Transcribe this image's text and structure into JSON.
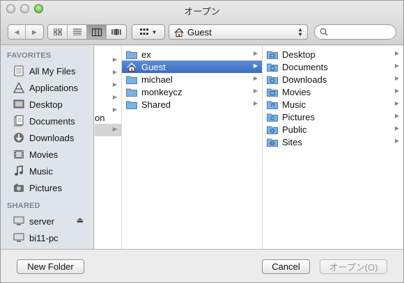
{
  "window": {
    "title": "オープン"
  },
  "toolbar": {
    "path_label": "Guest",
    "search_placeholder": "",
    "nav_icons": [
      "back-icon",
      "forward-icon"
    ],
    "view_icons": [
      "icon-view-icon",
      "list-view-icon",
      "column-view-icon",
      "coverflow-view-icon"
    ],
    "active_view": "column",
    "arrange_icon": "arrange-grid-icon"
  },
  "sidebar": {
    "favorites_heading": "FAVORITES",
    "favorites": [
      {
        "label": "All My Files",
        "icon": "all-files-icon"
      },
      {
        "label": "Applications",
        "icon": "applications-icon"
      },
      {
        "label": "Desktop",
        "icon": "desktop-icon"
      },
      {
        "label": "Documents",
        "icon": "documents-icon"
      },
      {
        "label": "Downloads",
        "icon": "downloads-icon"
      },
      {
        "label": "Movies",
        "icon": "movies-icon"
      },
      {
        "label": "Music",
        "icon": "music-icon"
      },
      {
        "label": "Pictures",
        "icon": "pictures-icon"
      }
    ],
    "shared_heading": "SHARED",
    "shared": [
      {
        "label": "server",
        "icon": "server-icon",
        "eject": true
      },
      {
        "label": "bi11-pc",
        "icon": "pc-icon",
        "eject": false
      }
    ]
  },
  "columns": {
    "col0_partial_text": "on",
    "col1": [
      {
        "label": "ex",
        "icon": "folder-icon"
      },
      {
        "label": "Guest",
        "icon": "home-folder-icon",
        "selected": true
      },
      {
        "label": "michael",
        "icon": "folder-icon"
      },
      {
        "label": "monkeycz",
        "icon": "folder-icon"
      },
      {
        "label": "Shared",
        "icon": "folder-icon"
      }
    ],
    "col2": [
      {
        "label": "Desktop",
        "icon": "desktop-folder-icon"
      },
      {
        "label": "Documents",
        "icon": "documents-folder-icon"
      },
      {
        "label": "Downloads",
        "icon": "downloads-folder-icon"
      },
      {
        "label": "Movies",
        "icon": "movies-folder-icon"
      },
      {
        "label": "Music",
        "icon": "music-folder-icon"
      },
      {
        "label": "Pictures",
        "icon": "pictures-folder-icon"
      },
      {
        "label": "Public",
        "icon": "public-folder-icon"
      },
      {
        "label": "Sites",
        "icon": "sites-folder-icon"
      }
    ]
  },
  "buttons": {
    "new_folder": "New Folder",
    "cancel": "Cancel",
    "open": "オープン(O)"
  },
  "colors": {
    "selection": "#3a6cc2",
    "sidebar_bg": "#dfe4ea",
    "folder": "#7fb0e0"
  }
}
